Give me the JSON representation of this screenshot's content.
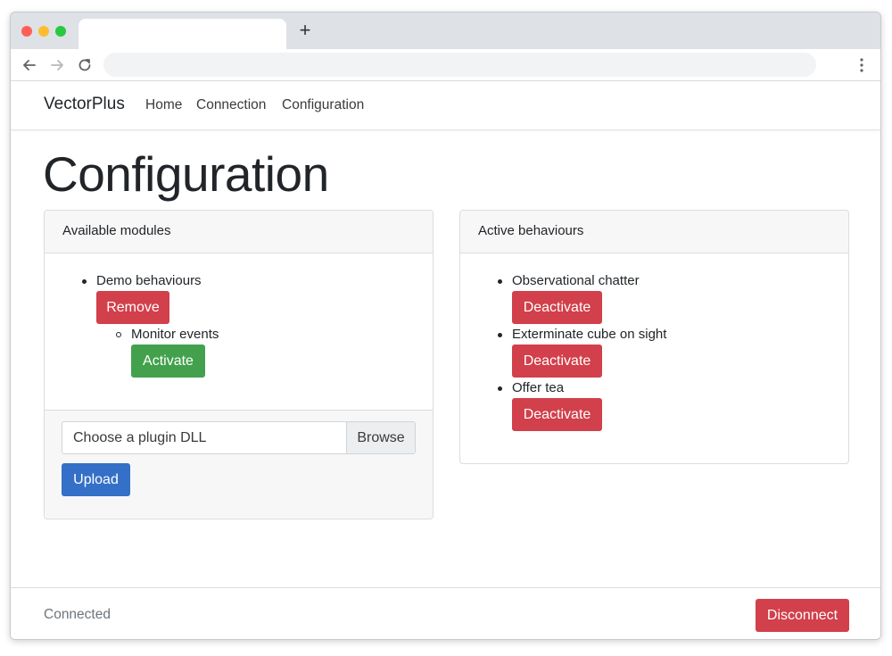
{
  "browser": {
    "icons": {
      "back": "arrow-left-icon",
      "forward": "arrow-right-icon",
      "reload": "reload-icon",
      "menu": "kebab-menu-icon",
      "new_tab": "plus-icon"
    },
    "new_tab_label": "+",
    "colors": {
      "close": "#ff5f57",
      "minimize": "#febc2e",
      "maximize": "#28c840",
      "chrome": "#dee1e6",
      "urlbar": "#f1f3f4"
    }
  },
  "navbar": {
    "brand": "VectorPlus",
    "links": [
      "Home",
      "Connection",
      "Configuration"
    ]
  },
  "page": {
    "title": "Configuration"
  },
  "available_modules": {
    "header": "Available modules",
    "modules": [
      {
        "name": "Demo behaviours",
        "action_label": "Remove",
        "behaviours": [
          {
            "name": "Monitor events",
            "action_label": "Activate"
          }
        ]
      }
    ],
    "upload": {
      "placeholder": "Choose a plugin DLL",
      "browse_label": "Browse",
      "upload_label": "Upload"
    }
  },
  "active_behaviours": {
    "header": "Active behaviours",
    "items": [
      {
        "name": "Observational chatter",
        "action_label": "Deactivate"
      },
      {
        "name": "Exterminate cube on sight",
        "action_label": "Deactivate"
      },
      {
        "name": "Offer tea",
        "action_label": "Deactivate"
      }
    ]
  },
  "footer": {
    "status": "Connected",
    "disconnect_label": "Disconnect"
  },
  "colors": {
    "danger": "#d1404b",
    "success": "#43a14d",
    "primary": "#3470c7",
    "muted_text": "#6c757d"
  }
}
